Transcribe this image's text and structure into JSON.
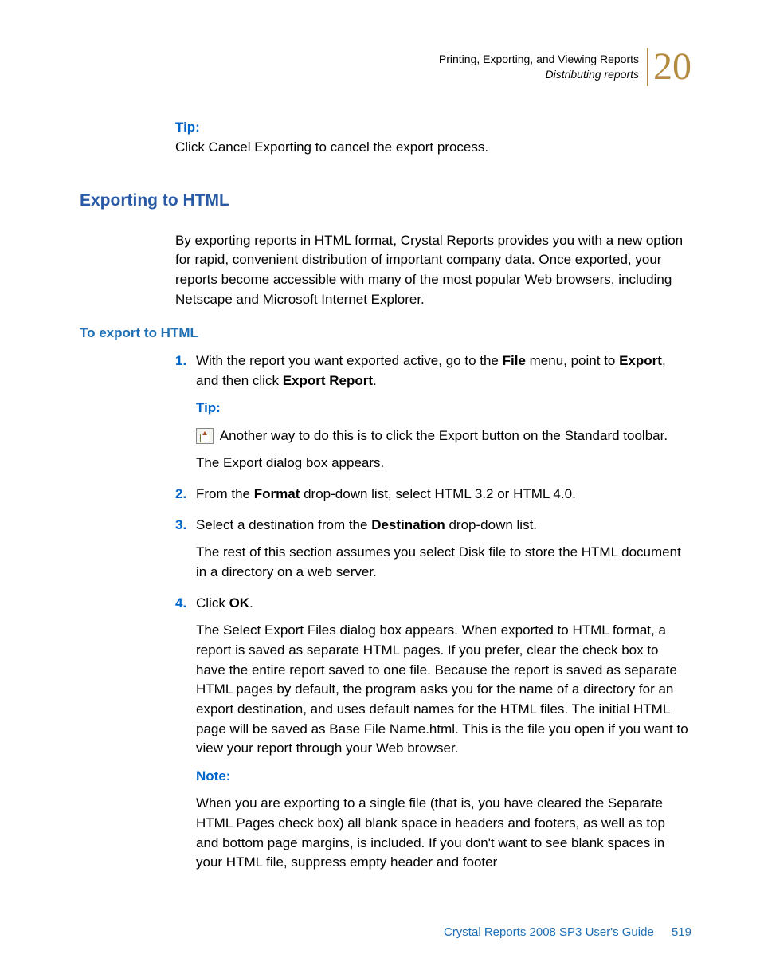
{
  "header": {
    "line1": "Printing, Exporting, and Viewing Reports",
    "line2": "Distributing reports",
    "chapter_number": "20"
  },
  "intro_tip": {
    "label": "Tip:",
    "text": "Click Cancel Exporting to cancel the export process."
  },
  "section": {
    "heading": "Exporting to HTML",
    "intro": "By exporting reports in HTML format, Crystal Reports provides you with a new option for rapid, convenient distribution of important company data. Once exported, your reports become accessible with many of the most popular Web browsers, including Netscape and Microsoft Internet Explorer.",
    "sub_heading": "To export to HTML"
  },
  "steps": [
    {
      "num": "1.",
      "text_pre": "With the report you want exported active, go to the ",
      "bold1": "File",
      "text_mid1": " menu, point to ",
      "bold2": "Export",
      "text_mid2": ", and then click ",
      "bold3": "Export Report",
      "text_post": ".",
      "tip_label": "Tip:",
      "tip_text": " Another way to do this is to click the Export button on the Standard toolbar.",
      "after_tip": "The Export dialog box appears.",
      "icon_name": "export-icon"
    },
    {
      "num": "2.",
      "text_pre": "From the ",
      "bold1": "Format",
      "text_post": " drop-down list, select HTML 3.2 or HTML 4.0."
    },
    {
      "num": "3.",
      "text_pre": "Select a destination from the ",
      "bold1": "Destination",
      "text_post": " drop-down list.",
      "after": "The rest of this section assumes you select Disk file to store the HTML document in a directory on a web server."
    },
    {
      "num": "4.",
      "text_pre": "Click ",
      "bold1": "OK",
      "text_post": ".",
      "after": "The Select Export Files dialog box appears. When exported to HTML format, a report is saved as separate HTML pages. If you prefer, clear the check box to have the entire report saved to one file. Because the report is saved as separate HTML pages by default, the program asks you for the name of a directory for an export destination, and uses default names for the HTML files. The initial HTML page will be saved as Base File Name.html. This is the file you open if you want to view your report through your Web browser.",
      "note_label": "Note:",
      "note_text": "When you are exporting to a single file (that is, you have cleared the Separate HTML Pages check box) all blank space in headers and footers, as well as top and bottom page margins, is included. If you don't want to see blank spaces in your HTML file, suppress empty header and footer"
    }
  ],
  "footer": {
    "guide": "Crystal Reports 2008 SP3 User's Guide",
    "page": "519"
  }
}
